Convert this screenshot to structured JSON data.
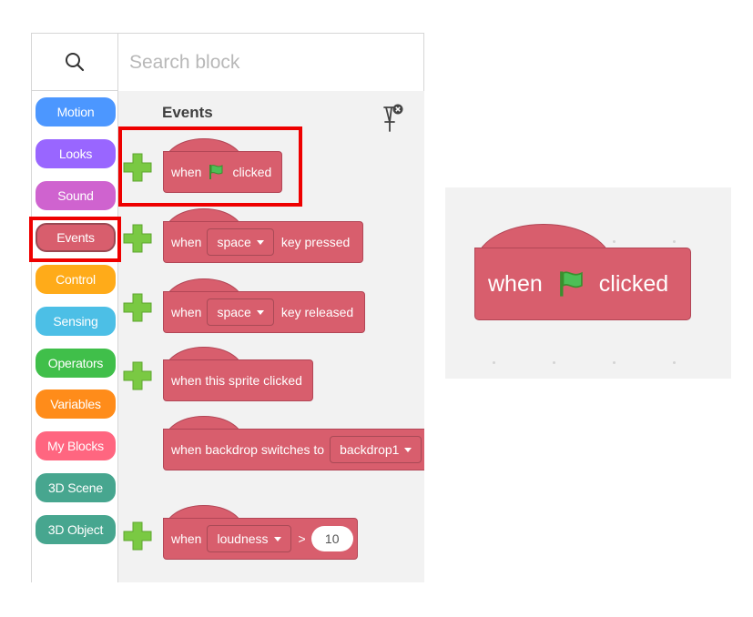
{
  "search": {
    "placeholder": "Search block"
  },
  "categories": [
    {
      "label": "Motion",
      "color": "#4c97ff"
    },
    {
      "label": "Looks",
      "color": "#9966ff"
    },
    {
      "label": "Sound",
      "color": "#cf63cf"
    },
    {
      "label": "Events",
      "color": "#d85e6d"
    },
    {
      "label": "Control",
      "color": "#ffab19"
    },
    {
      "label": "Sensing",
      "color": "#4cbfe6"
    },
    {
      "label": "Operators",
      "color": "#40bf4a"
    },
    {
      "label": "Variables",
      "color": "#ff8c1a"
    },
    {
      "label": "My Blocks",
      "color": "#ff6680"
    },
    {
      "label": "3D Scene",
      "color": "#47a68f"
    },
    {
      "label": "3D Object",
      "color": "#47a68f"
    }
  ],
  "selected_category": "Events",
  "palette": {
    "title": "Events",
    "blocks": {
      "flag_clicked": {
        "when": "when",
        "clicked": "clicked"
      },
      "key_pressed": {
        "when": "when",
        "key": "space",
        "suffix": "key pressed"
      },
      "key_released": {
        "when": "when",
        "key": "space",
        "suffix": "key released"
      },
      "sprite_clicked": {
        "label": "when this sprite clicked"
      },
      "backdrop_switch": {
        "label": "when backdrop switches to",
        "backdrop": "backdrop1"
      },
      "loudness": {
        "when": "when",
        "sensor": "loudness",
        "op": ">",
        "value": "10"
      }
    }
  },
  "zoom": {
    "when": "when",
    "clicked": "clicked"
  },
  "colors": {
    "event_block": "#d85e6d",
    "highlight": "#ee0000",
    "plus_green": "#7ac943"
  }
}
